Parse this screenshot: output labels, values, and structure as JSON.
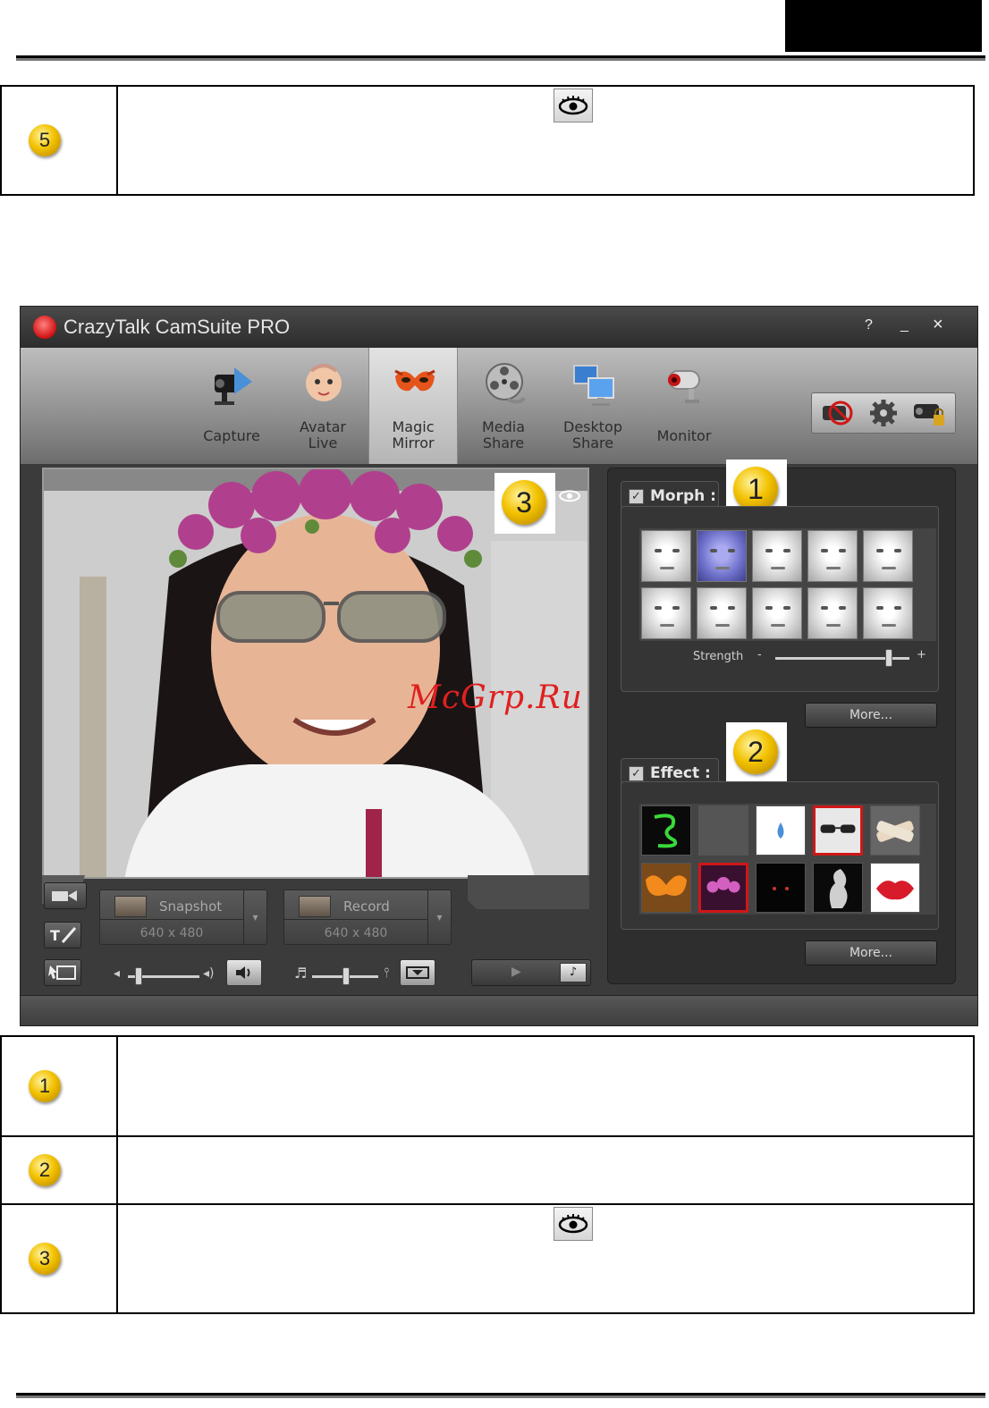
{
  "header": {
    "block": "black"
  },
  "top_table": {
    "rows": [
      {
        "number": "5",
        "icon": "eye-icon"
      }
    ]
  },
  "app": {
    "title": "CrazyTalk CamSuite PRO",
    "window_buttons": {
      "help": "?",
      "minimize": "_",
      "close": "×"
    },
    "tools": [
      {
        "label": "Capture",
        "icon": "webcam-icon",
        "active": false
      },
      {
        "label": "Avatar\nLive",
        "icon": "baby-face-icon",
        "active": false
      },
      {
        "label": "Magic\nMirror",
        "icon": "mask-icon",
        "active": true
      },
      {
        "label": "Media\nShare",
        "icon": "film-reel-icon",
        "active": false
      },
      {
        "label": "Desktop\nShare",
        "icon": "monitors-icon",
        "active": false
      },
      {
        "label": "Monitor",
        "icon": "security-camera-icon",
        "active": false
      }
    ],
    "top_right_icons": [
      "no-camera-icon",
      "gear-icon",
      "camera-lock-icon"
    ],
    "callouts": [
      "1",
      "2",
      "3"
    ],
    "snapshot": {
      "label": "Snapshot",
      "resolution": "640 x 480"
    },
    "record": {
      "label": "Record",
      "resolution": "640 x 480"
    },
    "morph": {
      "title": "Morph :",
      "checked": true,
      "strength_label": "Strength",
      "strength_min": "-",
      "strength_max": "+",
      "strength_level": 0.88,
      "selected_index": 1,
      "more": "More..."
    },
    "effect": {
      "title": "Effect :",
      "checked": true,
      "selected_indices": [
        3,
        6
      ],
      "more": "More..."
    },
    "colors": {
      "accent_red": "#d01717",
      "panel": "#2e2e2e"
    }
  },
  "bottom_table": {
    "rows": [
      {
        "number": "1"
      },
      {
        "number": "2"
      },
      {
        "number": "3",
        "icon": "eye-icon"
      }
    ]
  },
  "watermark": "McGrp.Ru"
}
